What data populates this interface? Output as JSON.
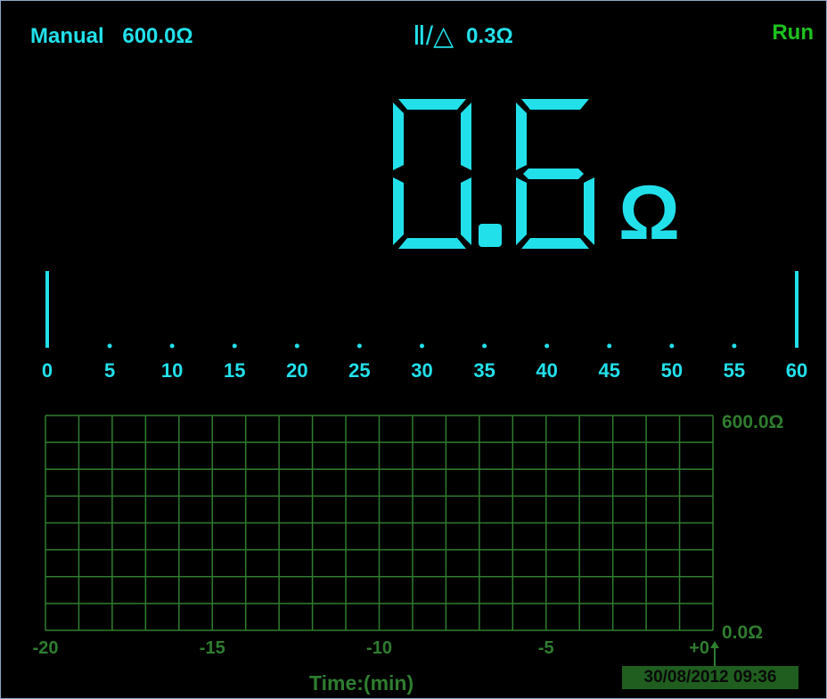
{
  "header": {
    "range_mode": "Manual",
    "range_value": "600.0Ω",
    "relative_symbol": "Ⅱ/△",
    "relative_value": "0.3Ω",
    "run_state": "Run"
  },
  "reading": {
    "digit_1": "0",
    "decimal": ".",
    "digit_2": "6",
    "unit": "Ω"
  },
  "bargraph": {
    "scale_labels": [
      "0",
      "5",
      "10",
      "15",
      "20",
      "25",
      "30",
      "35",
      "40",
      "45",
      "50",
      "55",
      "60"
    ],
    "scale_min": 0,
    "scale_max": 60,
    "value": 0.6
  },
  "trend": {
    "y_max_label": "600.0Ω",
    "y_min_label": "0.0Ω",
    "x_tick_labels": [
      "-20",
      "-15",
      "-10",
      "-5",
      "+0"
    ],
    "x_axis_title": "Time:(min)",
    "datetime": "30/08/2012  09:36"
  },
  "colors": {
    "reading": "#22e0ea",
    "run": "#1ec21e",
    "grid": "#2f7d2f",
    "background": "#000000"
  }
}
